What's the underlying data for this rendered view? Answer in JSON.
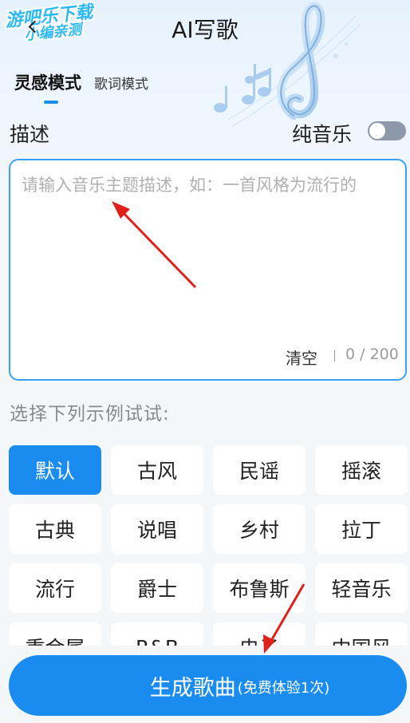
{
  "watermark": {
    "line1": "游吧乐下载",
    "line2": "小编亲测"
  },
  "header": {
    "title": "AI写歌",
    "back_icon": "chevron-left-icon"
  },
  "mode_tabs": {
    "active": "灵感模式",
    "inactive": "歌词模式"
  },
  "description": {
    "label": "描述",
    "pure_music_label": "纯音乐",
    "pure_music_on": false,
    "placeholder": "请输入音乐主题描述，如：一首风格为流行的",
    "value": "",
    "clear_label": "清空",
    "counter": "0 / 200"
  },
  "examples": {
    "label": "选择下列示例试试:",
    "genres": [
      "默认",
      "古风",
      "民谣",
      "摇滚",
      "古典",
      "说唱",
      "乡村",
      "拉丁",
      "流行",
      "爵士",
      "布鲁斯",
      "轻音乐",
      "重金属",
      "R&B",
      "电子",
      "中国风"
    ],
    "selected": "默认"
  },
  "generate": {
    "label": "生成歌曲",
    "sub_label": "(免费体验1次)"
  },
  "colors": {
    "accent": "#1a8cf0",
    "toggle_off": "#8d99ab",
    "annotation_arrow": "#e0201a"
  }
}
